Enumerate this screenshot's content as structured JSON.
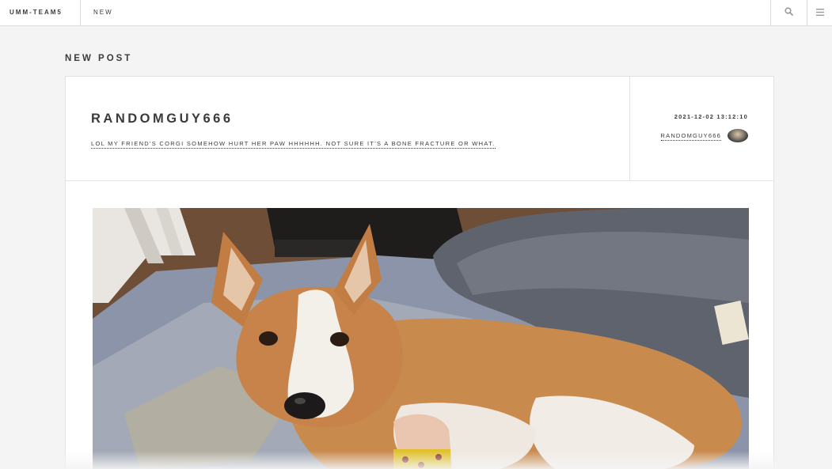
{
  "header": {
    "brand": "UMM-TEAM5",
    "nav_new": "NEW"
  },
  "page": {
    "heading": "NEW POST"
  },
  "post": {
    "title": "RANDOMGUY666",
    "caption": "LOL MY FRIEND'S CORGI SOMEHOW HURT HER PAW HHHHHH. NOT SURE IT'S A BONE FRACTURE OR WHAT.",
    "date": "2021-12-02 13:12:10",
    "author": "RANDOMGUY666"
  },
  "icons": {
    "search": "search-icon",
    "menu": "menu-icon"
  }
}
